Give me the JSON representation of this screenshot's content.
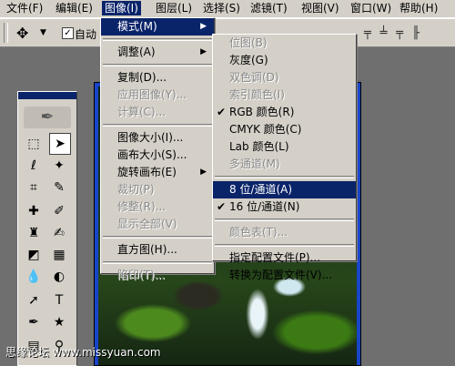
{
  "menubar": {
    "items": [
      "文件(F)",
      "编辑(E)",
      "图像(I)",
      "图层(L)",
      "选择(S)",
      "滤镜(T)",
      "视图(V)",
      "窗口(W)",
      "帮助(H)"
    ]
  },
  "options_bar": {
    "auto_select_label": "自动",
    "auto_select_checked": true
  },
  "image_menu": {
    "items": [
      {
        "label": "模式(M)",
        "submenu": true,
        "highlighted": true
      },
      {
        "sep": true
      },
      {
        "label": "调整(A)",
        "submenu": true
      },
      {
        "sep": true
      },
      {
        "label": "复制(D)..."
      },
      {
        "label": "应用图像(Y)...",
        "disabled": true
      },
      {
        "label": "计算(C)...",
        "disabled": true
      },
      {
        "sep": true
      },
      {
        "label": "图像大小(I)..."
      },
      {
        "label": "画布大小(S)..."
      },
      {
        "label": "旋转画布(E)",
        "submenu": true
      },
      {
        "label": "裁切(P)",
        "disabled": true
      },
      {
        "label": "修整(R)...",
        "disabled": true
      },
      {
        "label": "显示全部(V)",
        "disabled": true
      },
      {
        "sep": true
      },
      {
        "label": "直方图(H)..."
      },
      {
        "sep": true
      },
      {
        "label": "陷印(T)...",
        "disabled": true
      }
    ]
  },
  "mode_submenu": {
    "items": [
      {
        "label": "位图(B)",
        "disabled": true
      },
      {
        "label": "灰度(G)"
      },
      {
        "label": "双色调(D)",
        "disabled": true
      },
      {
        "label": "索引颜色(I)",
        "disabled": true
      },
      {
        "label": "RGB 颜色(R)",
        "checked": true
      },
      {
        "label": "CMYK 颜色(C)"
      },
      {
        "label": "Lab 颜色(L)"
      },
      {
        "label": "多通道(M)",
        "disabled": true
      },
      {
        "sep": true
      },
      {
        "label": "8 位/通道(A)",
        "highlighted": true
      },
      {
        "label": "16 位/通道(N)",
        "checked": true
      },
      {
        "sep": true
      },
      {
        "label": "颜色表(T)...",
        "disabled": true
      },
      {
        "sep": true
      },
      {
        "label": "指定配置文件(P)..."
      },
      {
        "label": "转换为配置文件(V)..."
      }
    ]
  },
  "watermark": "思缘论坛 www.missyuan.com",
  "icons": {
    "move_tool": "move-tool-icon",
    "marquee_tool": "marquee-tool-icon",
    "lasso_tool": "lasso-tool-icon",
    "magic_wand": "magic-wand-icon",
    "crop_tool": "crop-tool-icon",
    "slice_tool": "slice-tool-icon",
    "healing_brush": "healing-brush-icon",
    "brush_tool": "brush-tool-icon",
    "clone_stamp": "clone-stamp-icon",
    "history_brush": "history-brush-icon",
    "eraser": "eraser-icon",
    "gradient": "gradient-icon",
    "blur": "blur-icon",
    "dodge": "dodge-icon",
    "path_select": "path-select-icon",
    "type_tool": "type-tool-icon",
    "pen_tool": "pen-tool-icon",
    "shape_tool": "shape-tool-icon",
    "notes_tool": "notes-tool-icon",
    "eyedropper": "eyedropper-icon"
  },
  "colors": {
    "menu_bg": "#d4d0c8",
    "highlight": "#0a246a",
    "doc_border": "#1845c8"
  }
}
